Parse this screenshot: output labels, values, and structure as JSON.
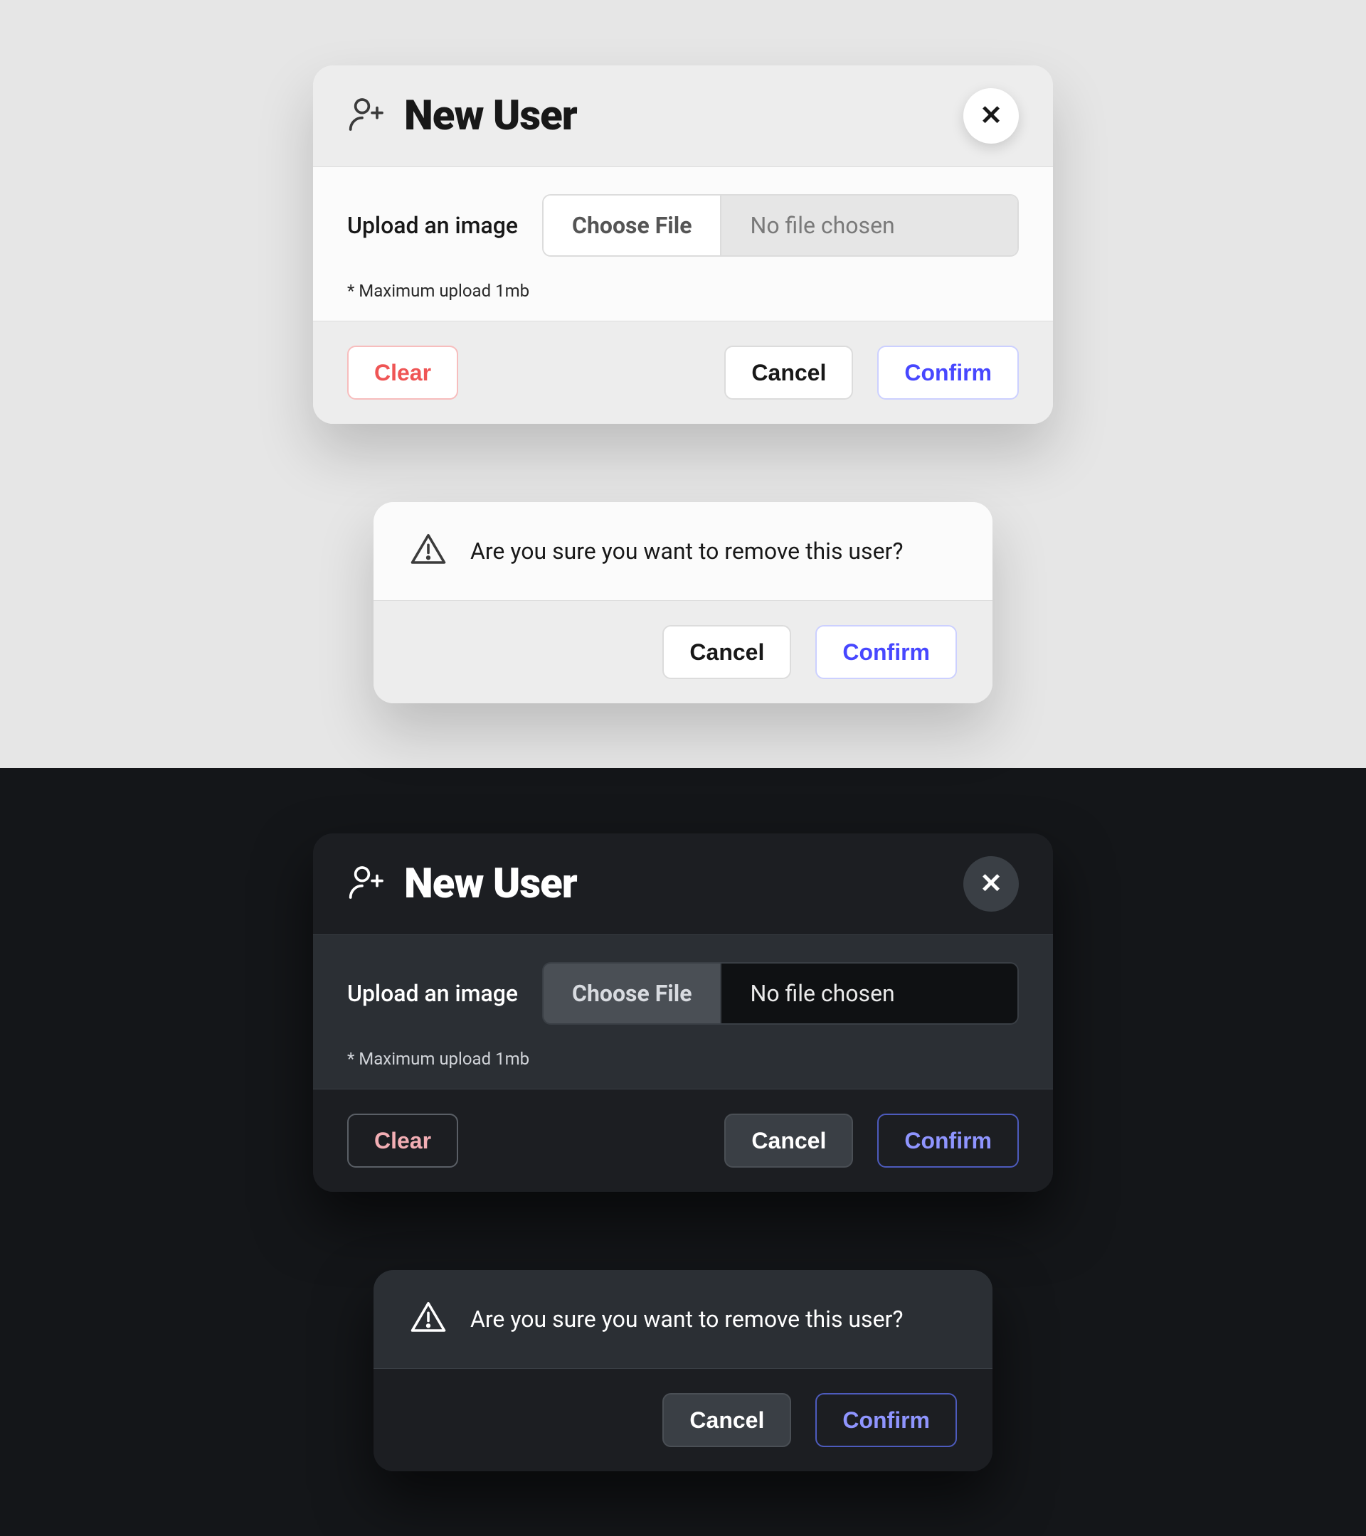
{
  "newUser": {
    "title": "New User",
    "uploadLabel": "Upload an image",
    "chooseFile": "Choose File",
    "fileStatus": "No file chosen",
    "hint": "* Maximum upload 1mb",
    "clear": "Clear",
    "cancel": "Cancel",
    "confirm": "Confirm"
  },
  "removeUser": {
    "message": "Are you sure you want to remove this user?",
    "cancel": "Cancel",
    "confirm": "Confirm"
  },
  "colors": {
    "lightBg": "#e6e6e6",
    "darkBg": "#141619",
    "primary": "#4747ff",
    "danger": "#ef5555"
  }
}
